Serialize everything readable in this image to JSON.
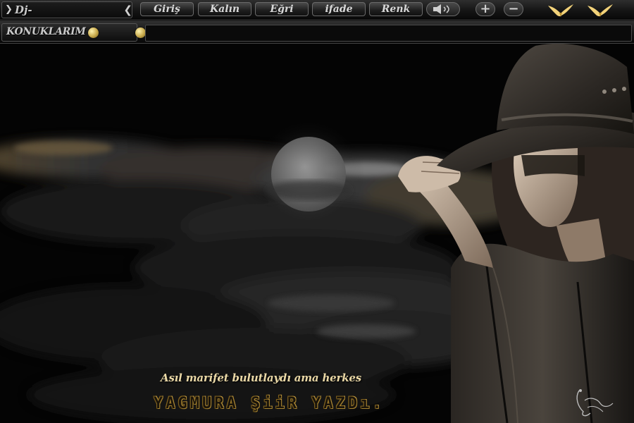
{
  "toolbar": {
    "dj_label": "Dj-",
    "buttons": [
      {
        "label": "Giriş"
      },
      {
        "label": "Kalın"
      },
      {
        "label": "Eğri"
      },
      {
        "label": "ifade"
      },
      {
        "label": "Renk"
      }
    ],
    "icons": [
      "speaker-icon",
      "zoom-in-icon",
      "zoom-out-icon",
      "bird-icon",
      "bird-icon"
    ]
  },
  "guests": {
    "label": "KONUKLARIM"
  },
  "chat_input": {
    "value": ""
  },
  "artwork": {
    "line1": "Asıl marifet bulutlaydı ama herkes",
    "line2": "YAGMURA ŞiiR YAZDı."
  },
  "colors": {
    "toolbar_text": "#c9c9c9",
    "gold_accent": "#c7a84a",
    "background": "#050505"
  }
}
